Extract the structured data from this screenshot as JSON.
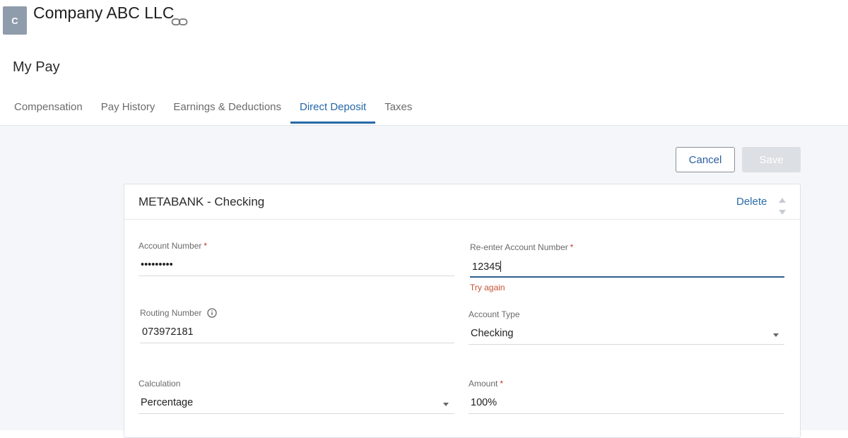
{
  "header": {
    "avatar_letter": "C",
    "company_name": "Company ABC LLC",
    "page_title": "My Pay"
  },
  "tabs": [
    {
      "label": "Compensation",
      "active": false
    },
    {
      "label": "Pay History",
      "active": false
    },
    {
      "label": "Earnings & Deductions",
      "active": false
    },
    {
      "label": "Direct Deposit",
      "active": true
    },
    {
      "label": "Taxes",
      "active": false
    }
  ],
  "actions": {
    "cancel_label": "Cancel",
    "save_label": "Save"
  },
  "card": {
    "title": "METABANK - Checking",
    "delete_label": "Delete"
  },
  "fields": {
    "account_number": {
      "label": "Account Number",
      "required": "*",
      "value": "•••••••••"
    },
    "reenter_account_number": {
      "label": "Re-enter Account Number",
      "required": "*",
      "value": "12345",
      "error": "Try again"
    },
    "routing_number": {
      "label": "Routing Number",
      "value": "073972181"
    },
    "account_type": {
      "label": "Account Type",
      "value": "Checking"
    },
    "calculation": {
      "label": "Calculation",
      "value": "Percentage"
    },
    "amount": {
      "label": "Amount",
      "required": "*",
      "value": "100%"
    }
  },
  "colors": {
    "accent": "#2569a8",
    "error": "#c75335",
    "content_background": "#f4f6f9"
  },
  "icons": {
    "link": "link-icon",
    "info": "info-icon",
    "sort": "sort-arrows-icon",
    "dropdown": "chevron-down-icon"
  }
}
